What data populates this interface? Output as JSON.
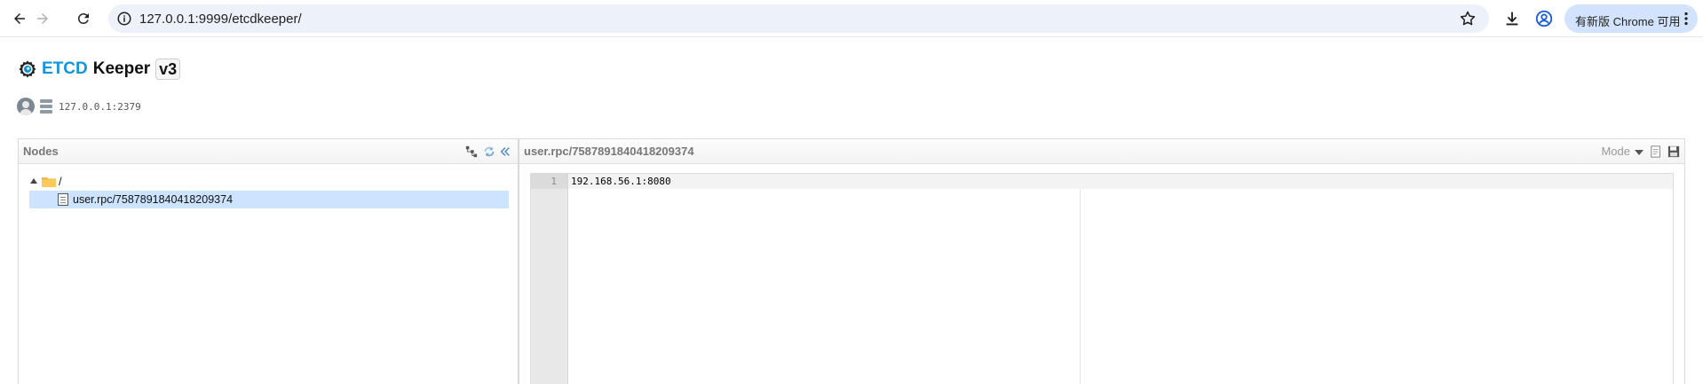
{
  "browser": {
    "url": "127.0.0.1:9999/etcdkeeper/",
    "update_label": "有新版 Chrome 可用"
  },
  "app": {
    "brand_etcd": "ETCD",
    "brand_keeper": "Keeper",
    "version": "v3",
    "server_address": "127.0.0.1:2379",
    "accent_color": "#1296db"
  },
  "nodes_panel": {
    "title": "Nodes",
    "tree": {
      "root_label": "/",
      "items": [
        {
          "label": "user.rpc/7587891840418209374",
          "selected": true
        }
      ]
    }
  },
  "editor_panel": {
    "title": "user.rpc/7587891840418209374",
    "mode_label": "Mode",
    "lines": [
      {
        "number": "1",
        "text": "192.168.56.1:8080"
      }
    ]
  }
}
